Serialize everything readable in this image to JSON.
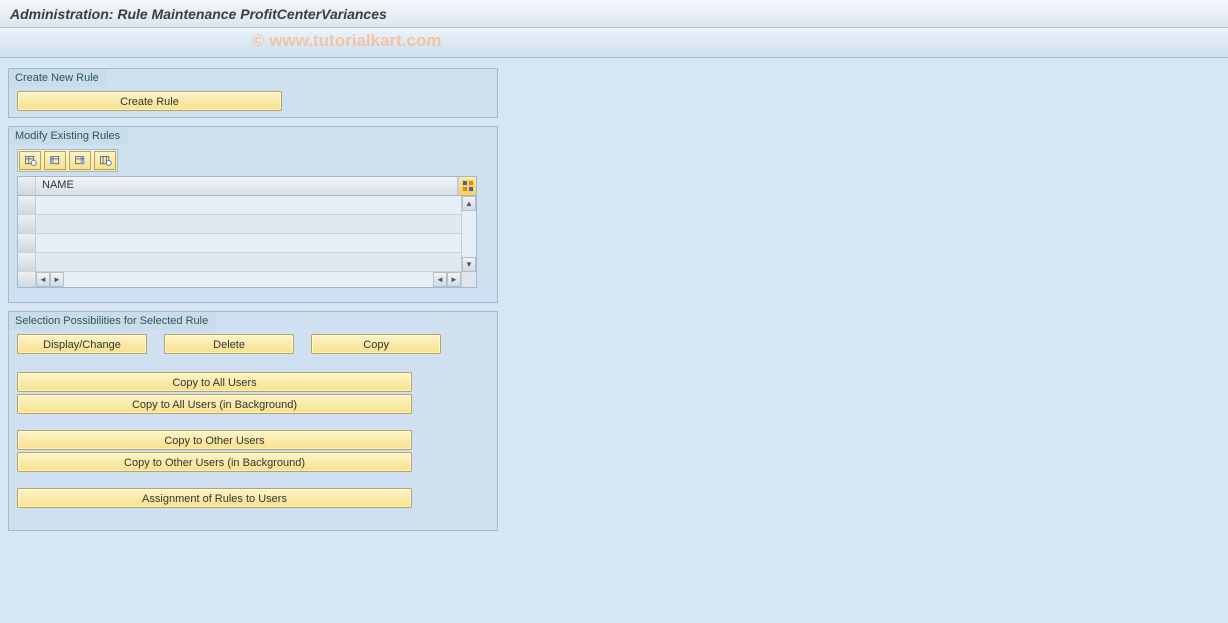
{
  "title": "Administration: Rule Maintenance ProfitCenterVariances",
  "watermark": "© www.tutorialkart.com",
  "group_create": {
    "title": "Create New Rule",
    "create_btn": "Create Rule"
  },
  "group_modify": {
    "title": "Modify Existing Rules",
    "column_name": "NAME",
    "rows": [
      "",
      "",
      "",
      ""
    ],
    "toolbar_icons": [
      "grid-settings-icon",
      "column-left-icon",
      "column-right-icon",
      "column-config-icon"
    ]
  },
  "group_selection": {
    "title": "Selection Possibilities for Selected Rule",
    "display_change": "Display/Change",
    "delete": "Delete",
    "copy": "Copy",
    "copy_all": "Copy to All Users",
    "copy_all_bg": "Copy to All Users (in Background)",
    "copy_other": "Copy to Other Users",
    "copy_other_bg": "Copy to Other Users (in Background)",
    "assignment": "Assignment of Rules to Users"
  }
}
